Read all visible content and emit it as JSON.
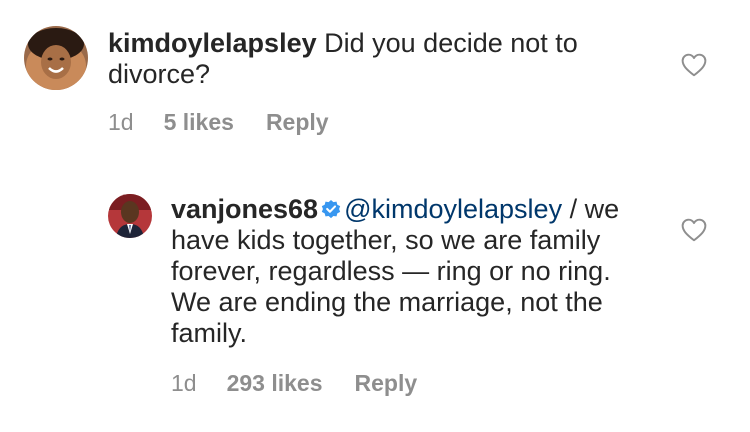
{
  "comments": [
    {
      "username": "kimdoylelapsley",
      "verified": false,
      "mention": "",
      "text": "Did you decide not to divorce?",
      "time": "1d",
      "likes": "5 likes",
      "reply": "Reply"
    },
    {
      "username": "vanjones68",
      "verified": true,
      "mention": "@kimdoylelapsley",
      "text_after_mention": " / we have kids together, so we are family forever, regardless — ring or no ring. We are ending the marriage, not the family.",
      "time": "1d",
      "likes": "293 likes",
      "reply": "Reply"
    }
  ],
  "icons": {
    "like": "heart-outline-icon",
    "verified": "verified-badge-icon"
  },
  "colors": {
    "text": "#262626",
    "meta": "#8e8e8e",
    "mention": "#00376b",
    "verified": "#3897f0"
  }
}
